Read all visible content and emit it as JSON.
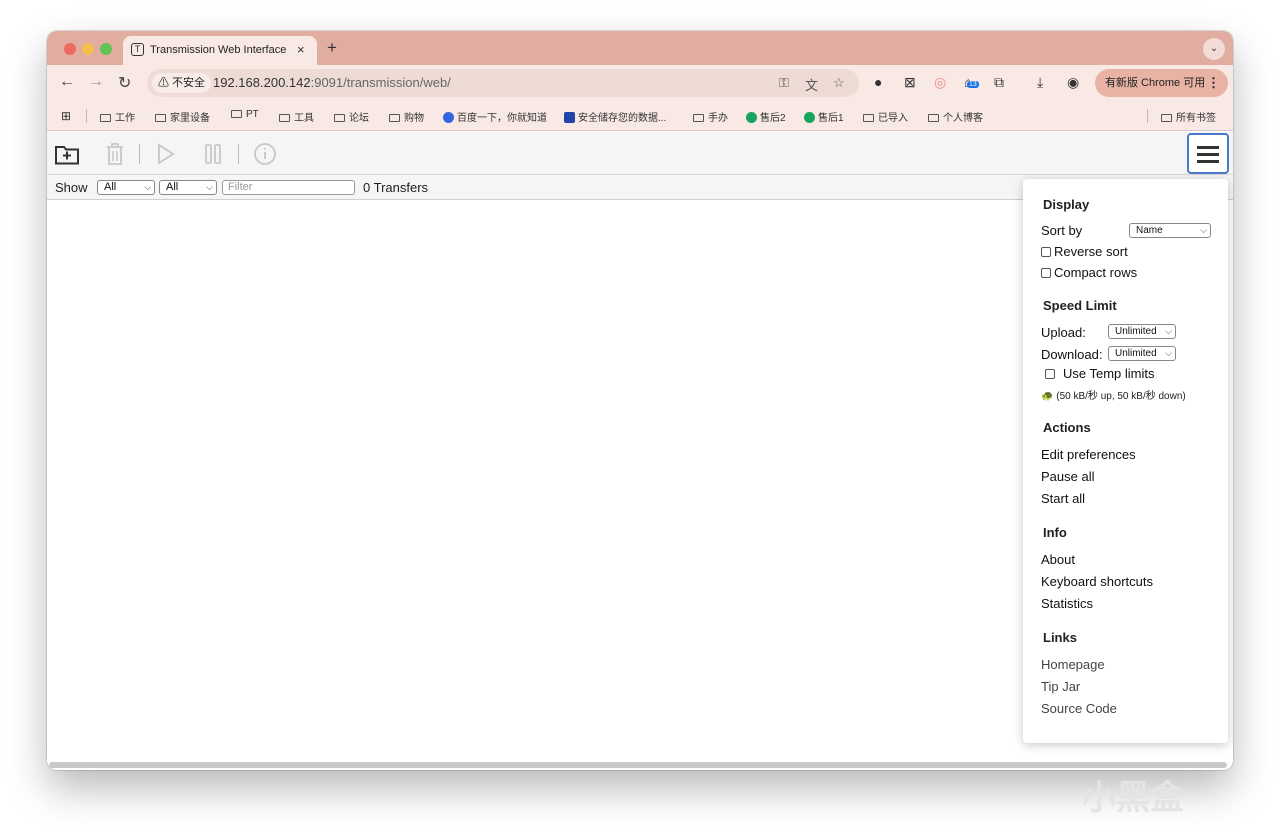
{
  "browser": {
    "tab_title": "Transmission Web Interface",
    "tab_close": "×",
    "new_tab": "+",
    "security_label": "⚠ 不安全",
    "url_host": "192.168.200.142",
    "url_path": ":9091/transmission/web/",
    "update_label": "有新版 Chrome 可用",
    "ext_badge": "13"
  },
  "bookmarks": [
    {
      "label": "工作",
      "icon": "folder-icon"
    },
    {
      "label": "家里设备",
      "icon": "folder-icon"
    },
    {
      "label": "PT",
      "icon": "folder-icon"
    },
    {
      "label": "工具",
      "icon": "folder-icon"
    },
    {
      "label": "论坛",
      "icon": "folder-icon"
    },
    {
      "label": "购物",
      "icon": "folder-icon"
    },
    {
      "label": "百度一下，你就知道",
      "icon": "baidu-icon"
    },
    {
      "label": "安全储存您的数据...",
      "icon": "site-icon"
    },
    {
      "label": "手办",
      "icon": "folder-icon"
    },
    {
      "label": "售后2",
      "icon": "globe-icon"
    },
    {
      "label": "售后1",
      "icon": "globe-icon"
    },
    {
      "label": "已导入",
      "icon": "folder-icon"
    },
    {
      "label": "个人博客",
      "icon": "folder-icon"
    }
  ],
  "all_bookmarks": "所有书签",
  "filterbar": {
    "show_label": "Show",
    "filter_state": "All",
    "filter_tracker": "All",
    "filter_placeholder": "Filter",
    "transfers": "0 Transfers"
  },
  "menu": {
    "display_header": "Display",
    "sort_by_label": "Sort by",
    "sort_by_value": "Name",
    "reverse_sort": "Reverse sort",
    "compact_rows": "Compact rows",
    "speed_header": "Speed Limit",
    "upload_label": "Upload:",
    "upload_value": "Unlimited",
    "download_label": "Download:",
    "download_value": "Unlimited",
    "temp_limits": "Use Temp limits",
    "temp_limits_note": "(50 kB/秒 up, 50 kB/秒 down)",
    "actions_header": "Actions",
    "edit_preferences": "Edit preferences",
    "pause_all": "Pause all",
    "start_all": "Start all",
    "info_header": "Info",
    "about": "About",
    "keyboard_shortcuts": "Keyboard shortcuts",
    "statistics": "Statistics",
    "links_header": "Links",
    "homepage": "Homepage",
    "tip_jar": "Tip Jar",
    "source_code": "Source Code"
  },
  "watermark": "小黑盒",
  "colors": {
    "tab_strip": "#e0ada0",
    "toolbar": "#f8e9e5",
    "menu_button_border": "#4a7ac9"
  }
}
